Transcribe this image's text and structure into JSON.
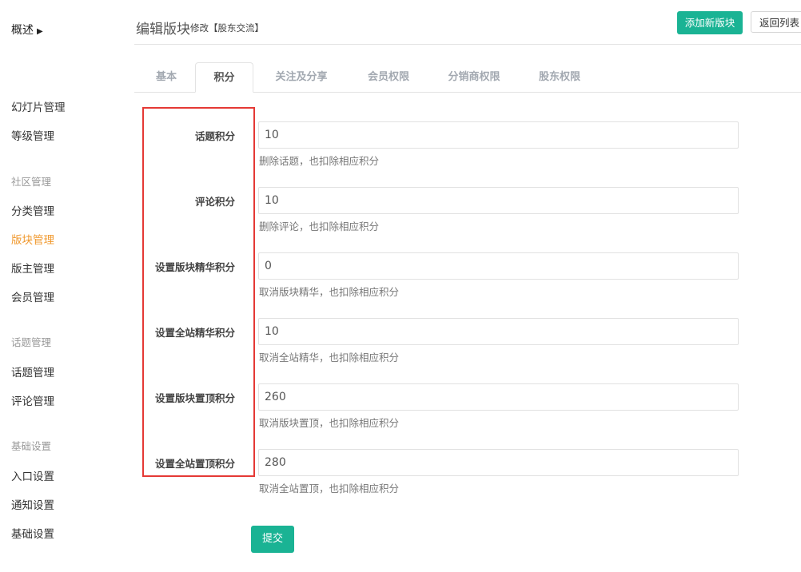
{
  "sidebar": {
    "overview": "概述",
    "items": [
      {
        "label": "幻灯片管理",
        "type": "item"
      },
      {
        "label": "等级管理",
        "type": "item"
      },
      {
        "label": "社区管理",
        "type": "group"
      },
      {
        "label": "分类管理",
        "type": "item"
      },
      {
        "label": "版块管理",
        "type": "item",
        "active": true
      },
      {
        "label": "版主管理",
        "type": "item"
      },
      {
        "label": "会员管理",
        "type": "item"
      },
      {
        "label": "话题管理",
        "type": "group"
      },
      {
        "label": "话题管理",
        "type": "item"
      },
      {
        "label": "评论管理",
        "type": "item"
      },
      {
        "label": "基础设置",
        "type": "group"
      },
      {
        "label": "入口设置",
        "type": "item"
      },
      {
        "label": "通知设置",
        "type": "item"
      },
      {
        "label": "基础设置",
        "type": "item"
      }
    ]
  },
  "header": {
    "title": "编辑版块",
    "subtitle": "修改【股东交流】",
    "add_button": "添加新版块",
    "back_button": "返回列表"
  },
  "tabs": [
    {
      "label": "基本"
    },
    {
      "label": "积分",
      "active": true
    },
    {
      "label": "关注及分享"
    },
    {
      "label": "会员权限"
    },
    {
      "label": "分销商权限"
    },
    {
      "label": "股东权限"
    }
  ],
  "fields": [
    {
      "label": "话题积分",
      "value": "10",
      "help": "删除话题，也扣除相应积分"
    },
    {
      "label": "评论积分",
      "value": "10",
      "help": "删除评论，也扣除相应积分"
    },
    {
      "label": "设置版块精华积分",
      "value": "0",
      "help": "取消版块精华，也扣除相应积分"
    },
    {
      "label": "设置全站精华积分",
      "value": "10",
      "help": "取消全站精华，也扣除相应积分"
    },
    {
      "label": "设置版块置顶积分",
      "value": "260",
      "help": "取消版块置顶，也扣除相应积分"
    },
    {
      "label": "设置全站置顶积分",
      "value": "280",
      "help": "取消全站置顶，也扣除相应积分"
    }
  ],
  "submit_label": "提交",
  "colors": {
    "primary": "#1ab394",
    "active_menu": "#f0982d",
    "highlight_box": "#e53935"
  }
}
